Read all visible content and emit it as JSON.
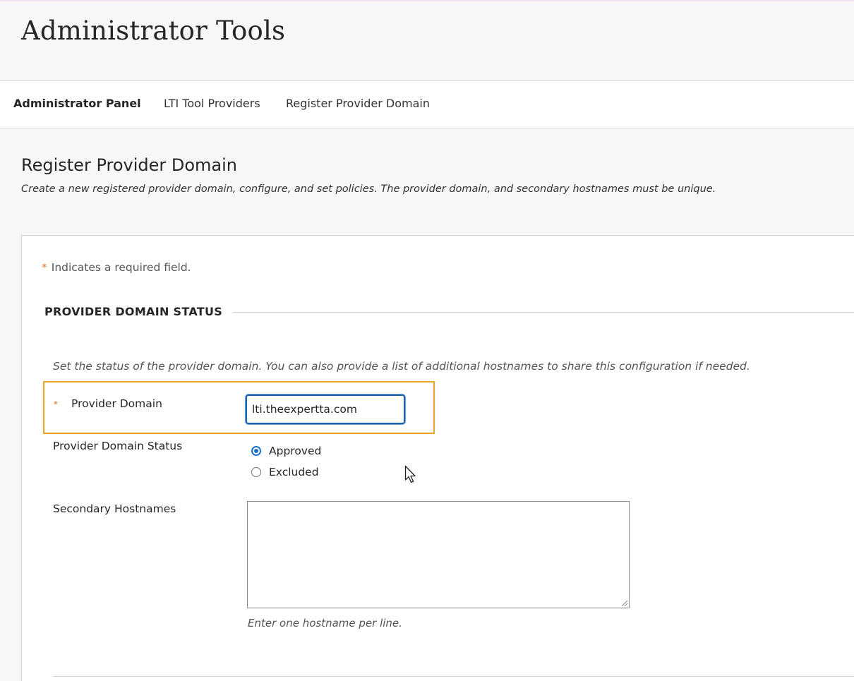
{
  "header": {
    "title": "Administrator Tools"
  },
  "breadcrumb": {
    "items": [
      {
        "label": "Administrator Panel"
      },
      {
        "label": "LTI Tool Providers"
      },
      {
        "label": "Register Provider Domain"
      }
    ]
  },
  "section": {
    "title": "Register Provider Domain",
    "description": "Create a new registered provider domain, configure, and set policies. The provider domain, and secondary hostnames must be unique."
  },
  "form": {
    "required_marker": "*",
    "required_note": "Indicates a required field.",
    "fieldset_title": "PROVIDER DOMAIN STATUS",
    "fieldset_description": "Set the status of the provider domain. You can also provide a list of additional hostnames to share this configuration if needed.",
    "provider_domain": {
      "label": "Provider Domain",
      "value": "lti.theexpertta.com"
    },
    "status": {
      "label": "Provider Domain Status",
      "options": [
        {
          "label": "Approved",
          "checked": true
        },
        {
          "label": "Excluded",
          "checked": false
        }
      ]
    },
    "secondary_hostnames": {
      "label": "Secondary Hostnames",
      "value": "",
      "hint": "Enter one hostname per line."
    }
  },
  "colors": {
    "accent": "#1a6fc9",
    "required": "#e07a2e",
    "highlight": "#e9a625"
  }
}
